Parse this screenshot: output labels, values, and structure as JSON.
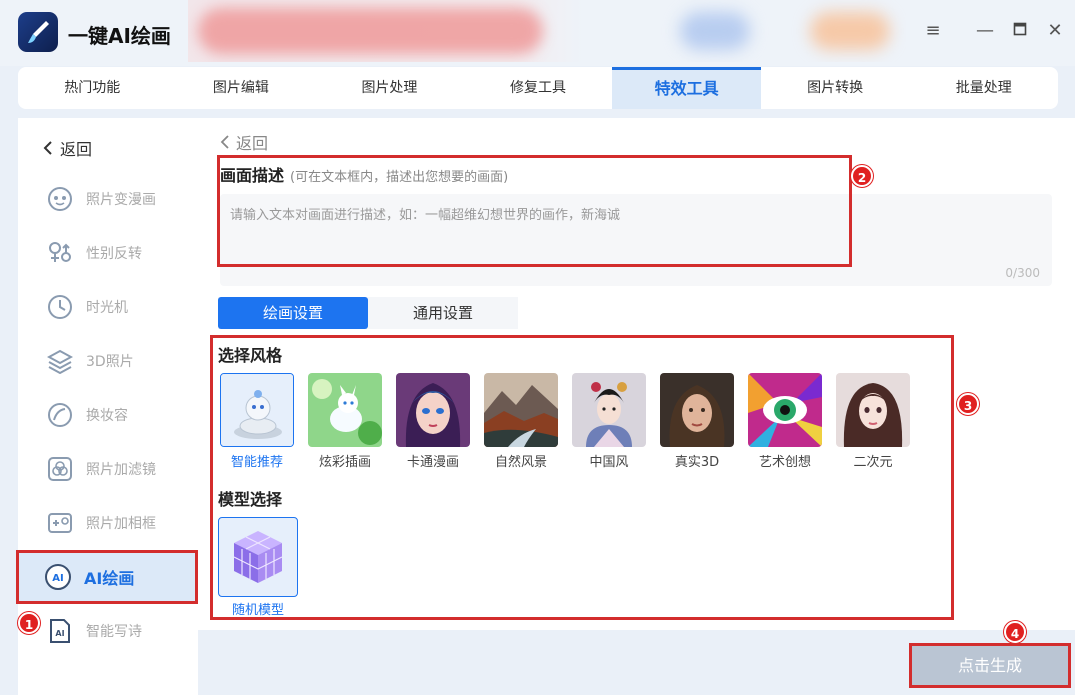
{
  "app": {
    "title": "一键AI绘画"
  },
  "window": {
    "menu": "≡",
    "minimize": "—",
    "maximize": "🗖",
    "close": "✕"
  },
  "tabs": [
    {
      "label": "热门功能"
    },
    {
      "label": "图片编辑"
    },
    {
      "label": "图片处理"
    },
    {
      "label": "修复工具"
    },
    {
      "label": "特效工具",
      "active": true
    },
    {
      "label": "图片转换"
    },
    {
      "label": "批量处理"
    }
  ],
  "sidebar": {
    "back_label": "返回",
    "items": [
      {
        "label": "照片变漫画",
        "icon": "face-mask-icon"
      },
      {
        "label": "性别反转",
        "icon": "gender-icon"
      },
      {
        "label": "时光机",
        "icon": "clock-icon"
      },
      {
        "label": "3D照片",
        "icon": "layers-icon"
      },
      {
        "label": "换妆容",
        "icon": "makeup-icon"
      },
      {
        "label": "照片加滤镜",
        "icon": "filter-icon"
      },
      {
        "label": "照片加相框",
        "icon": "frame-icon"
      },
      {
        "label": "AI绘画",
        "icon": "ai-palette-icon",
        "active": true
      },
      {
        "label": "智能写诗",
        "icon": "ai-document-icon"
      }
    ]
  },
  "main": {
    "back_label": "返回",
    "description": {
      "label": "画面描述",
      "hint": "(可在文本框内，描述出您想要的画面)",
      "placeholder": "请输入文本对画面进行描述，如：一幅超维幻想世界的画作，新海诚",
      "value": "",
      "counter": "0/300"
    },
    "settings_tabs": [
      {
        "label": "绘画设置",
        "active": true
      },
      {
        "label": "通用设置"
      }
    ],
    "style_section": {
      "title": "选择风格",
      "items": [
        {
          "label": "智能推荐",
          "selected": true
        },
        {
          "label": "炫彩插画"
        },
        {
          "label": "卡通漫画"
        },
        {
          "label": "自然风景"
        },
        {
          "label": "中国风"
        },
        {
          "label": "真实3D"
        },
        {
          "label": "艺术创想"
        },
        {
          "label": "二次元"
        }
      ]
    },
    "model_section": {
      "title": "模型选择",
      "items": [
        {
          "label": "随机模型",
          "selected": true
        }
      ]
    }
  },
  "generate_button": {
    "label": "点击生成"
  },
  "annotations": [
    "1",
    "2",
    "3",
    "4"
  ],
  "colors": {
    "accent": "#1d74f0",
    "annotation_red": "#d32d2d",
    "disabled_button": "#bac5d3"
  }
}
